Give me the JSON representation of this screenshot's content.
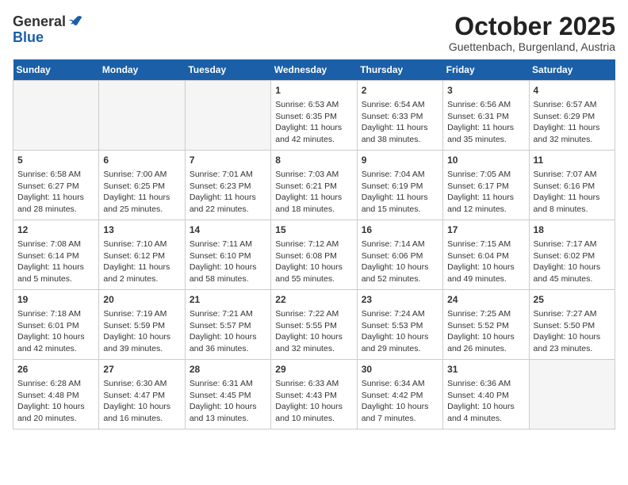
{
  "header": {
    "logo_general": "General",
    "logo_blue": "Blue",
    "title": "October 2025",
    "subtitle": "Guettenbach, Burgenland, Austria"
  },
  "days_of_week": [
    "Sunday",
    "Monday",
    "Tuesday",
    "Wednesday",
    "Thursday",
    "Friday",
    "Saturday"
  ],
  "weeks": [
    [
      {
        "day": "",
        "info": ""
      },
      {
        "day": "",
        "info": ""
      },
      {
        "day": "",
        "info": ""
      },
      {
        "day": "1",
        "info": "Sunrise: 6:53 AM\nSunset: 6:35 PM\nDaylight: 11 hours and 42 minutes."
      },
      {
        "day": "2",
        "info": "Sunrise: 6:54 AM\nSunset: 6:33 PM\nDaylight: 11 hours and 38 minutes."
      },
      {
        "day": "3",
        "info": "Sunrise: 6:56 AM\nSunset: 6:31 PM\nDaylight: 11 hours and 35 minutes."
      },
      {
        "day": "4",
        "info": "Sunrise: 6:57 AM\nSunset: 6:29 PM\nDaylight: 11 hours and 32 minutes."
      }
    ],
    [
      {
        "day": "5",
        "info": "Sunrise: 6:58 AM\nSunset: 6:27 PM\nDaylight: 11 hours and 28 minutes."
      },
      {
        "day": "6",
        "info": "Sunrise: 7:00 AM\nSunset: 6:25 PM\nDaylight: 11 hours and 25 minutes."
      },
      {
        "day": "7",
        "info": "Sunrise: 7:01 AM\nSunset: 6:23 PM\nDaylight: 11 hours and 22 minutes."
      },
      {
        "day": "8",
        "info": "Sunrise: 7:03 AM\nSunset: 6:21 PM\nDaylight: 11 hours and 18 minutes."
      },
      {
        "day": "9",
        "info": "Sunrise: 7:04 AM\nSunset: 6:19 PM\nDaylight: 11 hours and 15 minutes."
      },
      {
        "day": "10",
        "info": "Sunrise: 7:05 AM\nSunset: 6:17 PM\nDaylight: 11 hours and 12 minutes."
      },
      {
        "day": "11",
        "info": "Sunrise: 7:07 AM\nSunset: 6:16 PM\nDaylight: 11 hours and 8 minutes."
      }
    ],
    [
      {
        "day": "12",
        "info": "Sunrise: 7:08 AM\nSunset: 6:14 PM\nDaylight: 11 hours and 5 minutes."
      },
      {
        "day": "13",
        "info": "Sunrise: 7:10 AM\nSunset: 6:12 PM\nDaylight: 11 hours and 2 minutes."
      },
      {
        "day": "14",
        "info": "Sunrise: 7:11 AM\nSunset: 6:10 PM\nDaylight: 10 hours and 58 minutes."
      },
      {
        "day": "15",
        "info": "Sunrise: 7:12 AM\nSunset: 6:08 PM\nDaylight: 10 hours and 55 minutes."
      },
      {
        "day": "16",
        "info": "Sunrise: 7:14 AM\nSunset: 6:06 PM\nDaylight: 10 hours and 52 minutes."
      },
      {
        "day": "17",
        "info": "Sunrise: 7:15 AM\nSunset: 6:04 PM\nDaylight: 10 hours and 49 minutes."
      },
      {
        "day": "18",
        "info": "Sunrise: 7:17 AM\nSunset: 6:02 PM\nDaylight: 10 hours and 45 minutes."
      }
    ],
    [
      {
        "day": "19",
        "info": "Sunrise: 7:18 AM\nSunset: 6:01 PM\nDaylight: 10 hours and 42 minutes."
      },
      {
        "day": "20",
        "info": "Sunrise: 7:19 AM\nSunset: 5:59 PM\nDaylight: 10 hours and 39 minutes."
      },
      {
        "day": "21",
        "info": "Sunrise: 7:21 AM\nSunset: 5:57 PM\nDaylight: 10 hours and 36 minutes."
      },
      {
        "day": "22",
        "info": "Sunrise: 7:22 AM\nSunset: 5:55 PM\nDaylight: 10 hours and 32 minutes."
      },
      {
        "day": "23",
        "info": "Sunrise: 7:24 AM\nSunset: 5:53 PM\nDaylight: 10 hours and 29 minutes."
      },
      {
        "day": "24",
        "info": "Sunrise: 7:25 AM\nSunset: 5:52 PM\nDaylight: 10 hours and 26 minutes."
      },
      {
        "day": "25",
        "info": "Sunrise: 7:27 AM\nSunset: 5:50 PM\nDaylight: 10 hours and 23 minutes."
      }
    ],
    [
      {
        "day": "26",
        "info": "Sunrise: 6:28 AM\nSunset: 4:48 PM\nDaylight: 10 hours and 20 minutes."
      },
      {
        "day": "27",
        "info": "Sunrise: 6:30 AM\nSunset: 4:47 PM\nDaylight: 10 hours and 16 minutes."
      },
      {
        "day": "28",
        "info": "Sunrise: 6:31 AM\nSunset: 4:45 PM\nDaylight: 10 hours and 13 minutes."
      },
      {
        "day": "29",
        "info": "Sunrise: 6:33 AM\nSunset: 4:43 PM\nDaylight: 10 hours and 10 minutes."
      },
      {
        "day": "30",
        "info": "Sunrise: 6:34 AM\nSunset: 4:42 PM\nDaylight: 10 hours and 7 minutes."
      },
      {
        "day": "31",
        "info": "Sunrise: 6:36 AM\nSunset: 4:40 PM\nDaylight: 10 hours and 4 minutes."
      },
      {
        "day": "",
        "info": ""
      }
    ]
  ]
}
